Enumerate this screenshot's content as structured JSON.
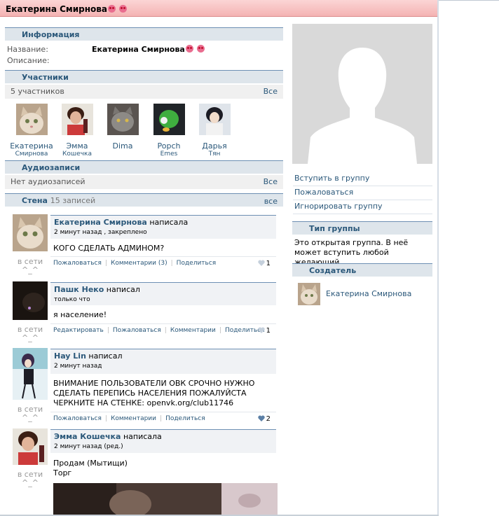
{
  "header": {
    "title": "Екатерина Смирнова"
  },
  "info": {
    "section_title": "Информация",
    "name_label": "Название:",
    "name_value": "Екатерина Смирнова",
    "description_label": "Описание:"
  },
  "members": {
    "section_title": "Участники",
    "count": "5 участников",
    "all_link": "Все",
    "list": [
      {
        "first": "Екатерина",
        "last": "Смирнова",
        "avatar": "cat-avatar"
      },
      {
        "first": "Эмма",
        "last": "Кошечка",
        "avatar": "girl-avatar"
      },
      {
        "first": "Dima",
        "last": "",
        "avatar": "grey-cat-avatar"
      },
      {
        "first": "Popch",
        "last": "Emes",
        "avatar": "green-creature-avatar"
      },
      {
        "first": "Дарья",
        "last": "Тян",
        "avatar": "anime-girl-avatar"
      }
    ]
  },
  "audio": {
    "section_title": "Аудиозаписи",
    "empty_text": "Нет аудиозаписей",
    "all_link": "Все"
  },
  "wall": {
    "section_title": "Стена",
    "count": "15 записей",
    "all_link": "все",
    "online_text": "в сети",
    "online_face": "^_^",
    "posts": [
      {
        "author": "Екатерина Смирнова",
        "verb": "написала",
        "meta": "2 минут назад , закреплено",
        "text": "КОГО СДЕЛАТЬ АДМИНОМ?",
        "actions": [
          "Пожаловаться",
          "Комментарии (3)",
          "Поделиться"
        ],
        "likes": "1"
      },
      {
        "author": "Пашк Неко",
        "verb": "написал",
        "meta": "только что",
        "text": "я население!",
        "actions": [
          "Редактировать",
          "Пожаловаться",
          "Комментарии",
          "Поделиться"
        ],
        "likes": "1"
      },
      {
        "author": "Hay Lin",
        "verb": "написал",
        "meta": "2 минут назад",
        "text": "ВНИМАНИЕ ПОЛЬЗОВАТЕЛИ ОВК СРОЧНО НУЖНО СДЕЛАТЬ ПЕРЕПИСЬ НАСЕЛЕНИЯ ПОЖАЛУЙСТА ЧЕРКНИТЕ НА СТЕНКЕ: openvk.org/club11746",
        "actions": [
          "Пожаловаться",
          "Комментарии",
          "Поделиться"
        ],
        "likes": "2"
      },
      {
        "author": "Эмма Кошечка",
        "verb": "написала",
        "meta": "2 минут назад (ред.)",
        "text_line1": "Продам (Мытищи)",
        "text_line2": "Торг"
      }
    ]
  },
  "sidebar": {
    "join_link": "Вступить в группу",
    "report_link": "Пожаловаться",
    "ignore_link": "Игнорировать группу",
    "type_title": "Тип группы",
    "type_text": "Это открытая группа. В неё может вступить любой желающий.",
    "creator_title": "Создатель",
    "creator_name": "Екатерина Смирнова"
  },
  "colors": {
    "header_bg": "#f4b3b3",
    "link": "#2b587a",
    "section_bg": "#dee5eb",
    "section_border": "#6d8fb3"
  }
}
